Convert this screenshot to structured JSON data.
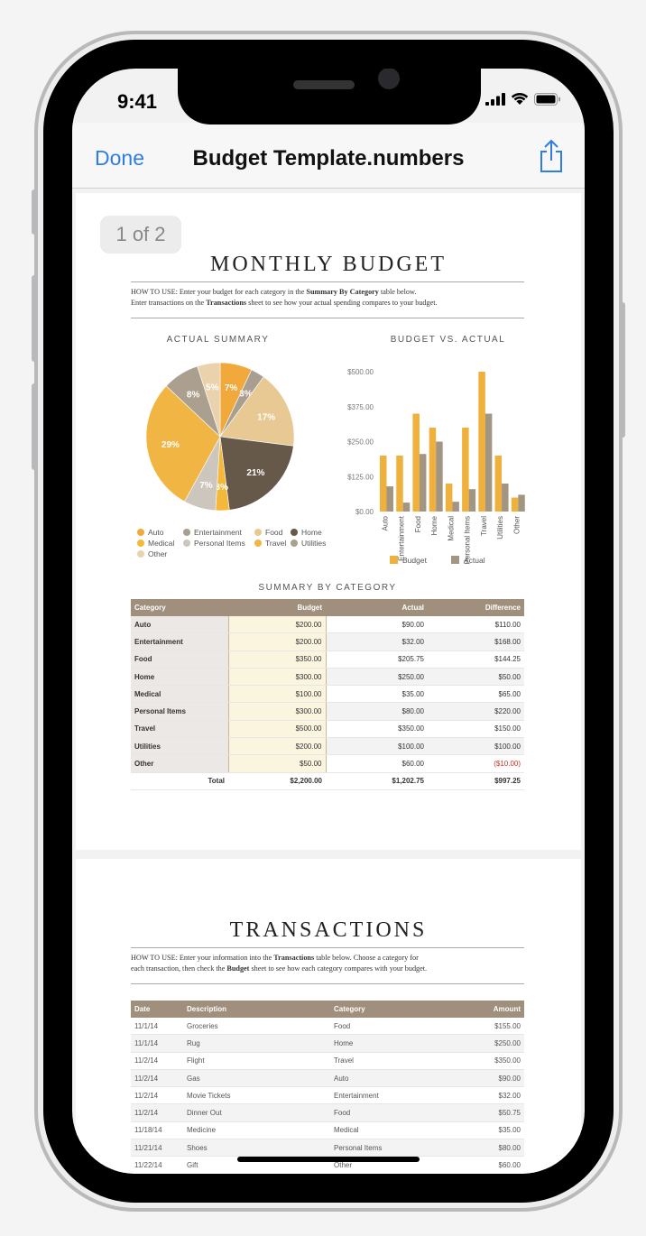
{
  "status": {
    "time": "9:41"
  },
  "nav": {
    "done": "Done",
    "title": "Budget Template.numbers"
  },
  "page_badge": "1 of 2",
  "page1": {
    "title": "MONTHLY BUDGET",
    "howto_line1_a": "HOW TO USE: Enter your budget for each category in the ",
    "howto_line1_b": "Summary By Category",
    "howto_line1_c": " table below.",
    "howto_line2_a": "Enter transactions on the ",
    "howto_line2_b": "Transactions",
    "howto_line2_c": " sheet to see how your actual spending compares to your budget.",
    "pie_title": "ACTUAL SUMMARY",
    "bar_title": "BUDGET VS. ACTUAL",
    "summary_title": "SUMMARY BY CATEGORY"
  },
  "colors": {
    "budget": "#f0b03c",
    "actual": "#a29582"
  },
  "chart_data": [
    {
      "type": "pie",
      "title": "ACTUAL SUMMARY",
      "slices": [
        {
          "label": "Auto",
          "value": 7,
          "display": "7%",
          "color": "#f2a93b"
        },
        {
          "label": "Entertainment",
          "value": 3,
          "display": "3%",
          "color": "#a99e92"
        },
        {
          "label": "Food",
          "value": 17,
          "display": "17%",
          "color": "#e9c993"
        },
        {
          "label": "Home",
          "value": 21,
          "display": "21%",
          "color": "#66594a"
        },
        {
          "label": "Medical",
          "value": 3,
          "display": "3%",
          "color": "#f4b93a"
        },
        {
          "label": "Personal Items",
          "value": 7,
          "display": "7%",
          "color": "#cdc6bd"
        },
        {
          "label": "Travel",
          "value": 29,
          "display": "29%",
          "color": "#f1b544"
        },
        {
          "label": "Utilities",
          "value": 8,
          "display": "8%",
          "color": "#aba08f"
        },
        {
          "label": "Other",
          "value": 5,
          "display": "5%",
          "color": "#ead3ac"
        }
      ],
      "legend": [
        "Auto",
        "Entertainment",
        "Food",
        "Home",
        "Medical",
        "Personal Items",
        "Travel",
        "Utilities",
        "Other"
      ]
    },
    {
      "type": "bar",
      "title": "BUDGET VS. ACTUAL",
      "categories": [
        "Auto",
        "Entertainment",
        "Food",
        "Home",
        "Medical",
        "Personal Items",
        "Travel",
        "Utilities",
        "Other"
      ],
      "series": [
        {
          "name": "Budget",
          "values": [
            200,
            200,
            350,
            300,
            100,
            300,
            500,
            200,
            50
          ]
        },
        {
          "name": "Actual",
          "values": [
            90,
            32,
            205.75,
            250,
            35,
            80,
            350,
            100,
            60
          ]
        }
      ],
      "yticks": [
        "$500.00",
        "$375.00",
        "$250.00",
        "$125.00",
        "$0.00"
      ],
      "ylim": [
        0,
        500
      ],
      "legend": [
        "Budget",
        "Actual"
      ],
      "legend_position": "bottom"
    }
  ],
  "summary_table": {
    "headers": [
      "Category",
      "Budget",
      "Actual",
      "Difference"
    ],
    "rows": [
      [
        "Auto",
        "$200.00",
        "$90.00",
        "$110.00"
      ],
      [
        "Entertainment",
        "$200.00",
        "$32.00",
        "$168.00"
      ],
      [
        "Food",
        "$350.00",
        "$205.75",
        "$144.25"
      ],
      [
        "Home",
        "$300.00",
        "$250.00",
        "$50.00"
      ],
      [
        "Medical",
        "$100.00",
        "$35.00",
        "$65.00"
      ],
      [
        "Personal Items",
        "$300.00",
        "$80.00",
        "$220.00"
      ],
      [
        "Travel",
        "$500.00",
        "$350.00",
        "$150.00"
      ],
      [
        "Utilities",
        "$200.00",
        "$100.00",
        "$100.00"
      ],
      [
        "Other",
        "$50.00",
        "$60.00",
        "($10.00)"
      ]
    ],
    "total": [
      "Total",
      "$2,200.00",
      "$1,202.75",
      "$997.25"
    ]
  },
  "page2": {
    "title": "TRANSACTIONS",
    "howto_line1_a": "HOW TO USE: Enter your information into the ",
    "howto_line1_b": "Transactions",
    "howto_line1_c": " table below. Choose a category for",
    "howto_line2_a": "each transaction, then check the ",
    "howto_line2_b": "Budget",
    "howto_line2_c": " sheet to see how each category compares with your budget."
  },
  "transactions_table": {
    "headers": [
      "Date",
      "Description",
      "Category",
      "Amount"
    ],
    "rows": [
      [
        "11/1/14",
        "Groceries",
        "Food",
        "$155.00"
      ],
      [
        "11/1/14",
        "Rug",
        "Home",
        "$250.00"
      ],
      [
        "11/2/14",
        "Flight",
        "Travel",
        "$350.00"
      ],
      [
        "11/2/14",
        "Gas",
        "Auto",
        "$90.00"
      ],
      [
        "11/2/14",
        "Movie Tickets",
        "Entertainment",
        "$32.00"
      ],
      [
        "11/2/14",
        "Dinner Out",
        "Food",
        "$50.75"
      ],
      [
        "11/18/14",
        "Medicine",
        "Medical",
        "$35.00"
      ],
      [
        "11/21/14",
        "Shoes",
        "Personal Items",
        "$80.00"
      ],
      [
        "11/22/14",
        "Gift",
        "Other",
        "$60.00"
      ]
    ]
  }
}
